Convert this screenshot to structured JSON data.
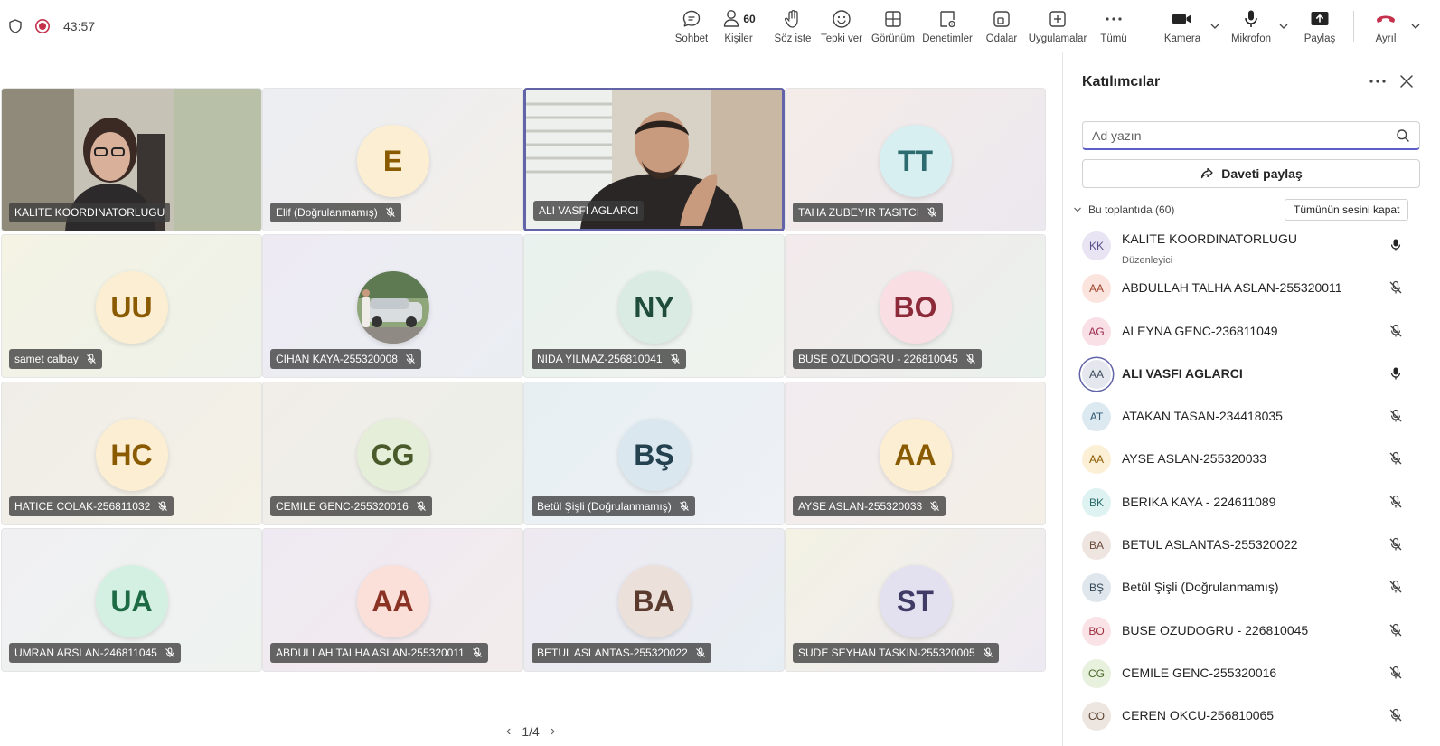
{
  "topbar": {
    "timer": "43:57",
    "buttons": [
      {
        "key": "chat",
        "label": "Sohbet"
      },
      {
        "key": "people",
        "label": "Kişiler",
        "count": "60"
      },
      {
        "key": "raise",
        "label": "Söz iste"
      },
      {
        "key": "react",
        "label": "Tepki ver"
      },
      {
        "key": "view",
        "label": "Görünüm"
      },
      {
        "key": "controls",
        "label": "Denetimler"
      },
      {
        "key": "rooms",
        "label": "Odalar"
      },
      {
        "key": "apps",
        "label": "Uygulamalar"
      },
      {
        "key": "more",
        "label": "Tümü"
      },
      {
        "key": "camera",
        "label": "Kamera"
      },
      {
        "key": "mic",
        "label": "Mikrofon"
      },
      {
        "key": "share",
        "label": "Paylaş"
      },
      {
        "key": "leave",
        "label": "Ayrıl"
      }
    ]
  },
  "stage": {
    "tiles": [
      {
        "name": "KALITE KOORDINATORLUGU",
        "video": true,
        "muted": false
      },
      {
        "name": "Elif (Doğrulanmamış)",
        "initials": "E",
        "bg": "#fbeed2",
        "fg": "#8a5a00",
        "muted": true
      },
      {
        "name": "ALI VASFI AGLARCI",
        "video": true,
        "muted": false,
        "speaking": true
      },
      {
        "name": "TAHA ZUBEYIR TASITCI",
        "initials": "TT",
        "bg": "#d7eff0",
        "fg": "#2c6b70",
        "muted": true
      },
      {
        "name": "samet calbay",
        "initials": "UU",
        "bg": "#fbeed2",
        "fg": "#8a5a00",
        "muted": true
      },
      {
        "name": "CIHAN KAYA-255320008",
        "photo": true,
        "muted": true
      },
      {
        "name": "NIDA YILMAZ-256810041",
        "initials": "NY",
        "bg": "#d9ebe3",
        "fg": "#1f4d3a",
        "muted": true
      },
      {
        "name": "BUSE OZUDOGRU - 226810045",
        "initials": "BO",
        "bg": "#f9dfe3",
        "fg": "#8c2a3a",
        "muted": true
      },
      {
        "name": "HATICE COLAK-256811032",
        "initials": "HC",
        "bg": "#fbeed2",
        "fg": "#8a5a00",
        "muted": true
      },
      {
        "name": "CEMILE GENC-255320016",
        "initials": "CG",
        "bg": "#e5eed9",
        "fg": "#4a5a2a",
        "muted": true
      },
      {
        "name": "Betül Şişli (Doğrulanmamış)",
        "initials": "BŞ",
        "bg": "#dbe7ee",
        "fg": "#24414f",
        "muted": true
      },
      {
        "name": "AYSE ASLAN-255320033",
        "initials": "AA",
        "bg": "#fbeed2",
        "fg": "#8a5a00",
        "muted": true
      },
      {
        "name": "UMRAN ARSLAN-246811045",
        "initials": "UA",
        "bg": "#d3f0e2",
        "fg": "#1d6a45",
        "muted": true
      },
      {
        "name": "ABDULLAH TALHA ASLAN-255320011",
        "initials": "AA",
        "bg": "#fbe0da",
        "fg": "#8a3324",
        "muted": true
      },
      {
        "name": "BETUL ASLANTAS-255320022",
        "initials": "BA",
        "bg": "#ece0da",
        "fg": "#5a3b2e",
        "muted": true
      },
      {
        "name": "SUDE SEYHAN TASKIN-255320005",
        "initials": "ST",
        "bg": "#e3e0f0",
        "fg": "#3f3a66",
        "muted": true
      }
    ],
    "pager": "1/4"
  },
  "panel": {
    "title": "Katılımcılar",
    "search_placeholder": "Ad yazın",
    "share_label": "Daveti paylaş",
    "section_label": "Bu toplantıda (60)",
    "mute_all_label": "Tümünün sesini kapat",
    "participants": [
      {
        "initials": "KK",
        "name": "KALITE KOORDINATORLUGU",
        "role": "Düzenleyici",
        "bg": "#e8e4f3",
        "fg": "#5a4e8a",
        "muted": false
      },
      {
        "initials": "AA",
        "name": "ABDULLAH TALHA ASLAN-255320011",
        "bg": "#fbe4de",
        "fg": "#a0452f",
        "muted": true
      },
      {
        "initials": "AG",
        "name": "ALEYNA GENC-236811049",
        "bg": "#f9dfe6",
        "fg": "#9c2e52",
        "muted": true
      },
      {
        "initials": "AA",
        "name": "ALI VASFI AGLARCI",
        "bg": "#e4e8ee",
        "fg": "#3d4a5c",
        "muted": false,
        "bold": true,
        "ring": true
      },
      {
        "initials": "AT",
        "name": "ATAKAN TASAN-234418035",
        "bg": "#dde9f0",
        "fg": "#2f5a73",
        "muted": true
      },
      {
        "initials": "AA",
        "name": "AYSE ASLAN-255320033",
        "bg": "#fbf0d6",
        "fg": "#8a5a00",
        "muted": true
      },
      {
        "initials": "BK",
        "name": "BERIKA KAYA - 224611089",
        "bg": "#dff2f2",
        "fg": "#2a6b6b",
        "muted": true
      },
      {
        "initials": "BA",
        "name": "BETUL ASLANTAS-255320022",
        "bg": "#eee5e0",
        "fg": "#6b4a3a",
        "muted": true
      },
      {
        "initials": "BŞ",
        "name": "Betül Şişli (Doğrulanmamış)",
        "bg": "#dfe6ec",
        "fg": "#2f4656",
        "muted": true
      },
      {
        "initials": "BO",
        "name": "BUSE OZUDOGRU - 226810045",
        "bg": "#fae3e6",
        "fg": "#9a2f3e",
        "muted": true
      },
      {
        "initials": "CG",
        "name": "CEMILE GENC-255320016",
        "bg": "#e8f0de",
        "fg": "#4a6a2a",
        "muted": true
      },
      {
        "initials": "CO",
        "name": "CEREN OKCU-256810065",
        "bg": "#ede6e0",
        "fg": "#5a4030",
        "muted": true
      }
    ]
  },
  "colors": {
    "accent": "#5b5fc7",
    "record": "#c4314b",
    "leave": "#c4314b"
  }
}
